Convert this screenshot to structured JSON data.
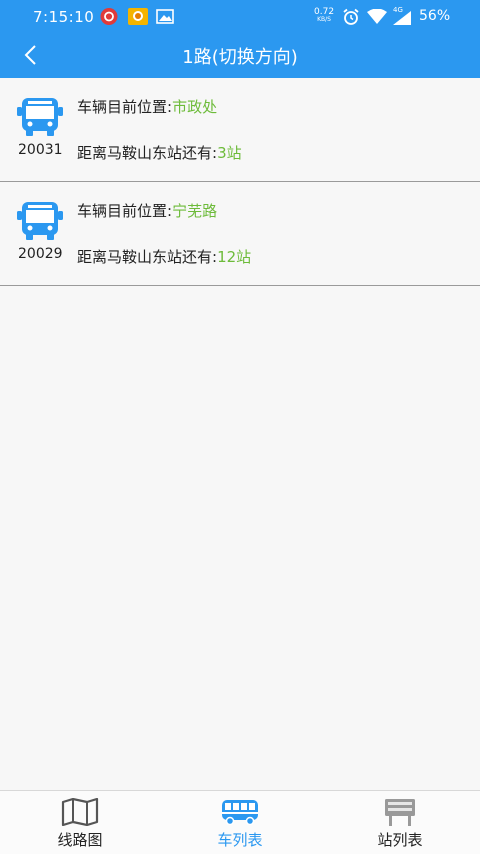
{
  "statusbar": {
    "time": "7:15:10",
    "net_speed": "0.72",
    "net_unit": "KB/S",
    "network": "4G",
    "battery": "56%"
  },
  "header": {
    "title": "1路(切换方向)"
  },
  "vehicles": [
    {
      "bus_number": "20031",
      "position_label": "车辆目前位置:",
      "position_value": "市政处",
      "distance_label": "距离马鞍山东站还有:",
      "distance_value": "3站"
    },
    {
      "bus_number": "20029",
      "position_label": "车辆目前位置:",
      "position_value": "宁芜路",
      "distance_label": "距离马鞍山东站还有:",
      "distance_value": "12站"
    }
  ],
  "tabs": [
    {
      "label": "线路图",
      "icon": "map-icon",
      "active": false
    },
    {
      "label": "车列表",
      "icon": "bus-icon",
      "active": true
    },
    {
      "label": "站列表",
      "icon": "station-sign-icon",
      "active": false
    }
  ],
  "colors": {
    "primary": "#2b98f0",
    "highlight_green": "#6dbb3a",
    "tab_inactive_icon": "#555555"
  }
}
